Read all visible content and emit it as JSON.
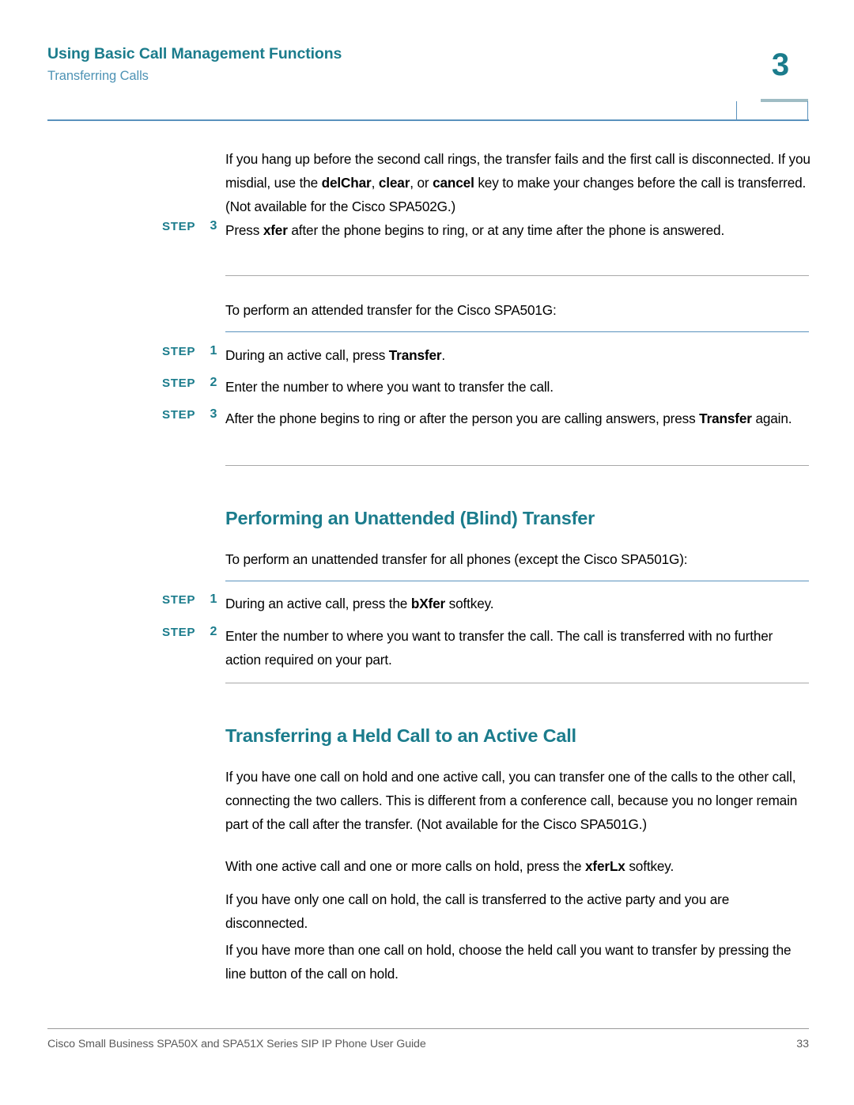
{
  "header": {
    "title": "Using Basic Call Management Functions",
    "subtitle": "Transferring Calls",
    "chapter_number": "3",
    "accent_color": "#1b7c8c",
    "subtitle_color": "#4e93b5",
    "rule_color": "#5a92bd"
  },
  "body": {
    "intro_paragraph": {
      "part1": "If you hang up before the second call rings, the transfer fails and the first call is disconnected. If you misdial, use the ",
      "bold1": "delChar",
      "part2": ", ",
      "bold2": "clear",
      "part3": ", or ",
      "bold3": "cancel",
      "part4": " key to make your changes before the call is transferred. (Not available for the Cisco SPA502G.)"
    },
    "step_3_top": {
      "label": "STEP",
      "number": "3",
      "text_part1": "Press ",
      "bold1": "xfer",
      "text_part2": " after the phone begins to ring, or at any time after the phone is answered."
    },
    "attended_intro": "To perform an attended transfer for the Cisco SPA501G:",
    "attended_steps": [
      {
        "label": "STEP",
        "number": "1",
        "text_part1": "During an active call, press ",
        "bold1": "Transfer",
        "text_part2": "."
      },
      {
        "label": "STEP",
        "number": "2",
        "text_part1": "Enter the number to where you want to transfer the call.",
        "bold1": "",
        "text_part2": ""
      },
      {
        "label": "STEP",
        "number": "3",
        "text_part1": "After the phone begins to ring or after the person you are calling answers, press ",
        "bold1": "Transfer",
        "text_part2": " again."
      }
    ],
    "heading_unattended": "Performing an Unattended (Blind) Transfer",
    "unattended_intro": "To perform an unattended transfer for all phones (except the Cisco SPA501G):",
    "unattended_steps": [
      {
        "label": "STEP",
        "number": "1",
        "text_part1": "During an active call, press the ",
        "bold1": "bXfer",
        "text_part2": " softkey."
      },
      {
        "label": "STEP",
        "number": "2",
        "text_part1": "Enter the number to where you want to transfer the call. The call is transferred with no further action required on your part.",
        "bold1": "",
        "text_part2": ""
      }
    ],
    "heading_held_call": "Transferring a Held Call to an Active Call",
    "held_paragraph_1": "If you have one call on hold and one active call, you can transfer one of the calls to the other call, connecting the two callers. This is different from a conference call, because you no longer remain part of the call after the transfer. (Not available for the Cisco SPA501G.)",
    "held_paragraph_2": {
      "part1": "With one active call and one or more calls on hold, press the ",
      "bold1": "xferLx",
      "part2": " softkey."
    },
    "held_paragraph_3": "If you have only one call on hold, the call is transferred to the active party and you are disconnected.",
    "held_paragraph_4": "If you have more than one call on hold, choose the held call you want to transfer by pressing the line button of the call on hold."
  },
  "footer": {
    "guide_title": "Cisco Small Business SPA50X and SPA51X Series SIP IP Phone User Guide",
    "page_number": "33"
  }
}
